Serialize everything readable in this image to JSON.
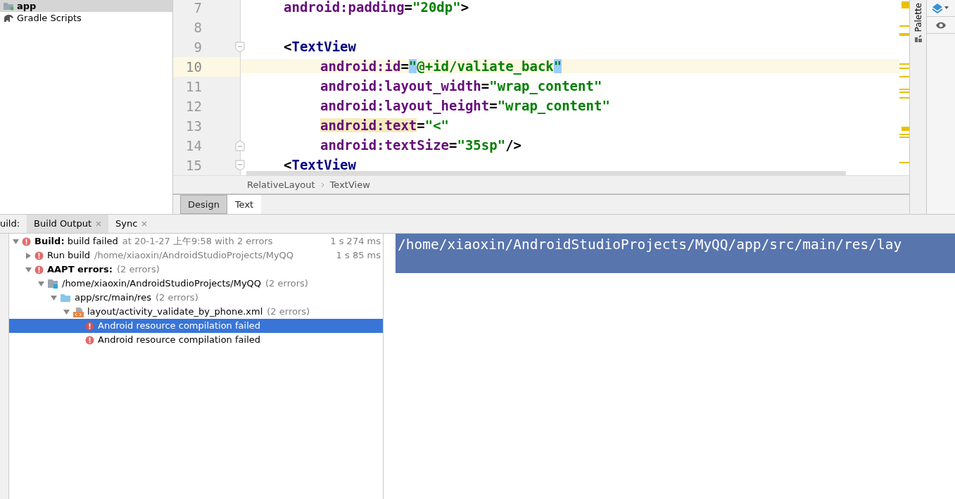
{
  "project_tree": [
    {
      "label": "app",
      "kind": "module",
      "selected": true
    },
    {
      "label": "Gradle Scripts",
      "kind": "gradle",
      "selected": false
    }
  ],
  "editor": {
    "lines": [
      {
        "number": "7",
        "current": false,
        "segments": [
          {
            "kind": "attr",
            "text": "android:padding"
          },
          {
            "kind": "punct",
            "text": "="
          },
          {
            "kind": "value",
            "text": "\"20dp\""
          },
          {
            "kind": "punct",
            "text": ">"
          }
        ]
      },
      {
        "number": "8",
        "current": false
      },
      {
        "number": "9",
        "current": false,
        "fold_start": true,
        "segments": [
          {
            "kind": "punct",
            "text": "<"
          },
          {
            "kind": "tag",
            "text": "TextView"
          }
        ],
        "children": [
          {
            "number": "10",
            "current": true,
            "segments": [
              {
                "kind": "attr",
                "text": "android:id"
              },
              {
                "kind": "punct",
                "text": "="
              },
              {
                "kind": "value",
                "text": "\"",
                "matched": true
              },
              {
                "kind": "value",
                "text": "@+id/valiate_back"
              },
              {
                "kind": "value",
                "text": "\"",
                "matched": true
              }
            ]
          },
          {
            "number": "11",
            "current": false,
            "segments": [
              {
                "kind": "attr",
                "text": "android:layout_width"
              },
              {
                "kind": "punct",
                "text": "="
              },
              {
                "kind": "value",
                "text": "\"wrap_content\""
              }
            ]
          },
          {
            "number": "12",
            "current": false,
            "segments": [
              {
                "kind": "attr",
                "text": "android:layout_height"
              },
              {
                "kind": "punct",
                "text": "="
              },
              {
                "kind": "value",
                "text": "\"wrap_content\""
              }
            ]
          },
          {
            "number": "13",
            "current": false,
            "segments": [
              {
                "kind": "attr",
                "text": "android:text",
                "warning": true
              },
              {
                "kind": "punct",
                "text": "="
              },
              {
                "kind": "value",
                "text": "\"<\""
              }
            ]
          },
          {
            "number": "14",
            "current": false,
            "fold_end": true,
            "segments": [
              {
                "kind": "attr",
                "text": "android:textSize"
              },
              {
                "kind": "punct",
                "text": "="
              },
              {
                "kind": "value",
                "text": "\"35sp\""
              },
              {
                "kind": "punct",
                "text": "/>"
              }
            ]
          }
        ]
      },
      {
        "number": "15",
        "current": false,
        "fold_start": true,
        "segments": [
          {
            "kind": "punct",
            "text": "<"
          },
          {
            "kind": "tag",
            "text": "TextView"
          }
        ]
      }
    ],
    "breadcrumb": [
      "RelativeLayout",
      "TextView"
    ],
    "mode_tabs": [
      {
        "label": "Design",
        "selected": false
      },
      {
        "label": "Text",
        "selected": true
      }
    ],
    "side_tab": "Palette"
  },
  "build": {
    "label": "uild:",
    "tabs": [
      {
        "label": "Build Output",
        "selected": true,
        "closable": true
      },
      {
        "label": "Sync",
        "selected": false,
        "closable": true
      }
    ],
    "tree": [
      {
        "kind": "error",
        "label": "**Build:** build failed",
        "detail": "at 20-1-27 上午9:58  with 2 errors",
        "time": "1 s 274 ms",
        "expanded": true,
        "selected": false,
        "children": [
          {
            "kind": "error",
            "label": "Run build",
            "detail": "/home/xiaoxin/AndroidStudioProjects/MyQQ",
            "time": "1 s 85 ms",
            "expanded": false,
            "selected": false
          },
          {
            "kind": "error",
            "label": "**AAPT errors:**",
            "detail": "(2 errors)",
            "expanded": true,
            "selected": false,
            "children": [
              {
                "kind": "project",
                "label": "/home/xiaoxin/AndroidStudioProjects/MyQQ",
                "detail": "(2 errors)",
                "expanded": true,
                "selected": false,
                "children": [
                  {
                    "kind": "folder",
                    "label": "app/src/main/res",
                    "detail": "(2 errors)",
                    "expanded": true,
                    "selected": false,
                    "children": [
                      {
                        "kind": "xml",
                        "label": "layout/activity_validate_by_phone.xml",
                        "detail": "(2 errors)",
                        "expanded": true,
                        "selected": false,
                        "children": [
                          {
                            "kind": "error",
                            "label": "Android resource compilation failed",
                            "selected": true
                          },
                          {
                            "kind": "error",
                            "label": "Android resource compilation failed",
                            "selected": false
                          }
                        ]
                      }
                    ]
                  }
                ]
              }
            ]
          }
        ]
      }
    ],
    "console": "/home/xiaoxin/AndroidStudioProjects/MyQQ/app/src/main/res/lay"
  }
}
